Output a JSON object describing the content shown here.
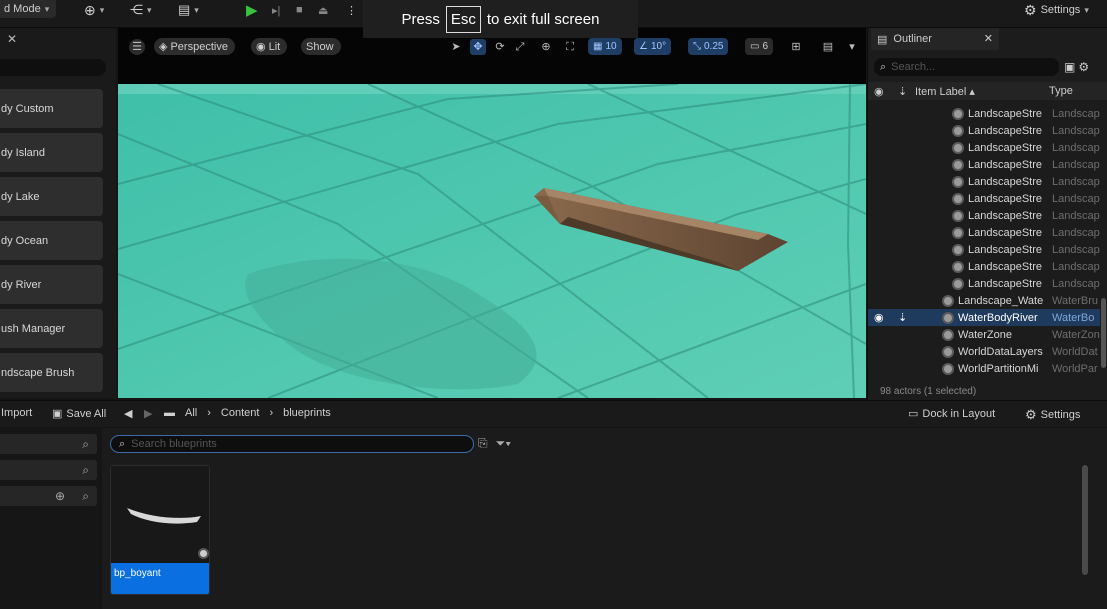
{
  "topbar": {
    "mode_label": "d Mode",
    "settings_label": "Settings"
  },
  "fullscreen_notice": {
    "press": "Press",
    "key": "Esc",
    "rest": "to exit full screen"
  },
  "place_actors": {
    "items": [
      {
        "label": "dy Custom"
      },
      {
        "label": "dy Island"
      },
      {
        "label": "dy Lake"
      },
      {
        "label": "dy Ocean"
      },
      {
        "label": "dy River"
      },
      {
        "label": "ush Manager"
      },
      {
        "label": "ndscape Brush"
      }
    ]
  },
  "viewport": {
    "perspective_label": "Perspective",
    "lit_label": "Lit",
    "show_label": "Show",
    "grid_snap": "10",
    "rotation_snap": "10°",
    "scale_snap": "0.25",
    "camera_speed": "6"
  },
  "outliner": {
    "tab_label": "Outliner",
    "search_placeholder": "Search...",
    "col_label": "Item Label ▴",
    "col_type": "Type",
    "rows": [
      {
        "name": "LandscapeStre",
        "type": "Landscap",
        "indent": 2,
        "selected": false
      },
      {
        "name": "LandscapeStre",
        "type": "Landscap",
        "indent": 2,
        "selected": false
      },
      {
        "name": "LandscapeStre",
        "type": "Landscap",
        "indent": 2,
        "selected": false
      },
      {
        "name": "LandscapeStre",
        "type": "Landscap",
        "indent": 2,
        "selected": false
      },
      {
        "name": "LandscapeStre",
        "type": "Landscap",
        "indent": 2,
        "selected": false
      },
      {
        "name": "LandscapeStre",
        "type": "Landscap",
        "indent": 2,
        "selected": false
      },
      {
        "name": "LandscapeStre",
        "type": "Landscap",
        "indent": 2,
        "selected": false
      },
      {
        "name": "LandscapeStre",
        "type": "Landscap",
        "indent": 2,
        "selected": false
      },
      {
        "name": "LandscapeStre",
        "type": "Landscap",
        "indent": 2,
        "selected": false
      },
      {
        "name": "LandscapeStre",
        "type": "Landscap",
        "indent": 2,
        "selected": false
      },
      {
        "name": "LandscapeStre",
        "type": "Landscap",
        "indent": 2,
        "selected": false
      },
      {
        "name": "Landscape_Wate",
        "type": "WaterBru",
        "indent": 1,
        "selected": false
      },
      {
        "name": "WaterBodyRiver",
        "type": "WaterBo",
        "indent": 1,
        "selected": true
      },
      {
        "name": "WaterZone",
        "type": "WaterZon",
        "indent": 1,
        "selected": false
      },
      {
        "name": "WorldDataLayers",
        "type": "WorldDat",
        "indent": 1,
        "selected": false
      },
      {
        "name": "WorldPartitionMi",
        "type": "WorldPar",
        "indent": 1,
        "selected": false
      }
    ],
    "footer": "98 actors (1 selected)"
  },
  "content_browser": {
    "import_label": "Import",
    "save_all_label": "Save All",
    "breadcrumb": [
      "All",
      "Content",
      "blueprints"
    ],
    "dock_label": "Dock in Layout",
    "settings_label": "Settings",
    "search_placeholder": "Search blueprints",
    "assets": [
      {
        "name": "bp_boyant"
      }
    ]
  }
}
